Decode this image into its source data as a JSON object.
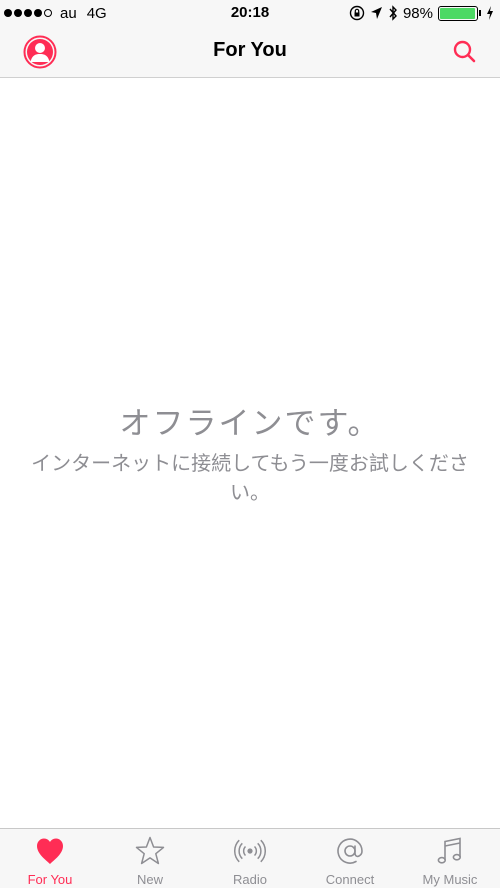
{
  "status_bar": {
    "carrier": "au",
    "network": "4G",
    "time": "20:18",
    "battery_percent": "98%",
    "battery_level": 0.98,
    "signal_bars_filled": 4,
    "signal_bars_total": 5
  },
  "nav": {
    "title": "For You"
  },
  "main": {
    "offline_title": "オフラインです。",
    "offline_message": "インターネットに接続してもう一度お試しください。"
  },
  "tabs": [
    {
      "label": "For You",
      "icon": "heart-icon",
      "active": true
    },
    {
      "label": "New",
      "icon": "star-icon",
      "active": false
    },
    {
      "label": "Radio",
      "icon": "radio-icon",
      "active": false
    },
    {
      "label": "Connect",
      "icon": "at-icon",
      "active": false
    },
    {
      "label": "My Music",
      "icon": "music-note-icon",
      "active": false
    }
  ],
  "colors": {
    "accent": "#ff2d55",
    "inactive": "#8e8e93",
    "battery": "#4cd964"
  }
}
